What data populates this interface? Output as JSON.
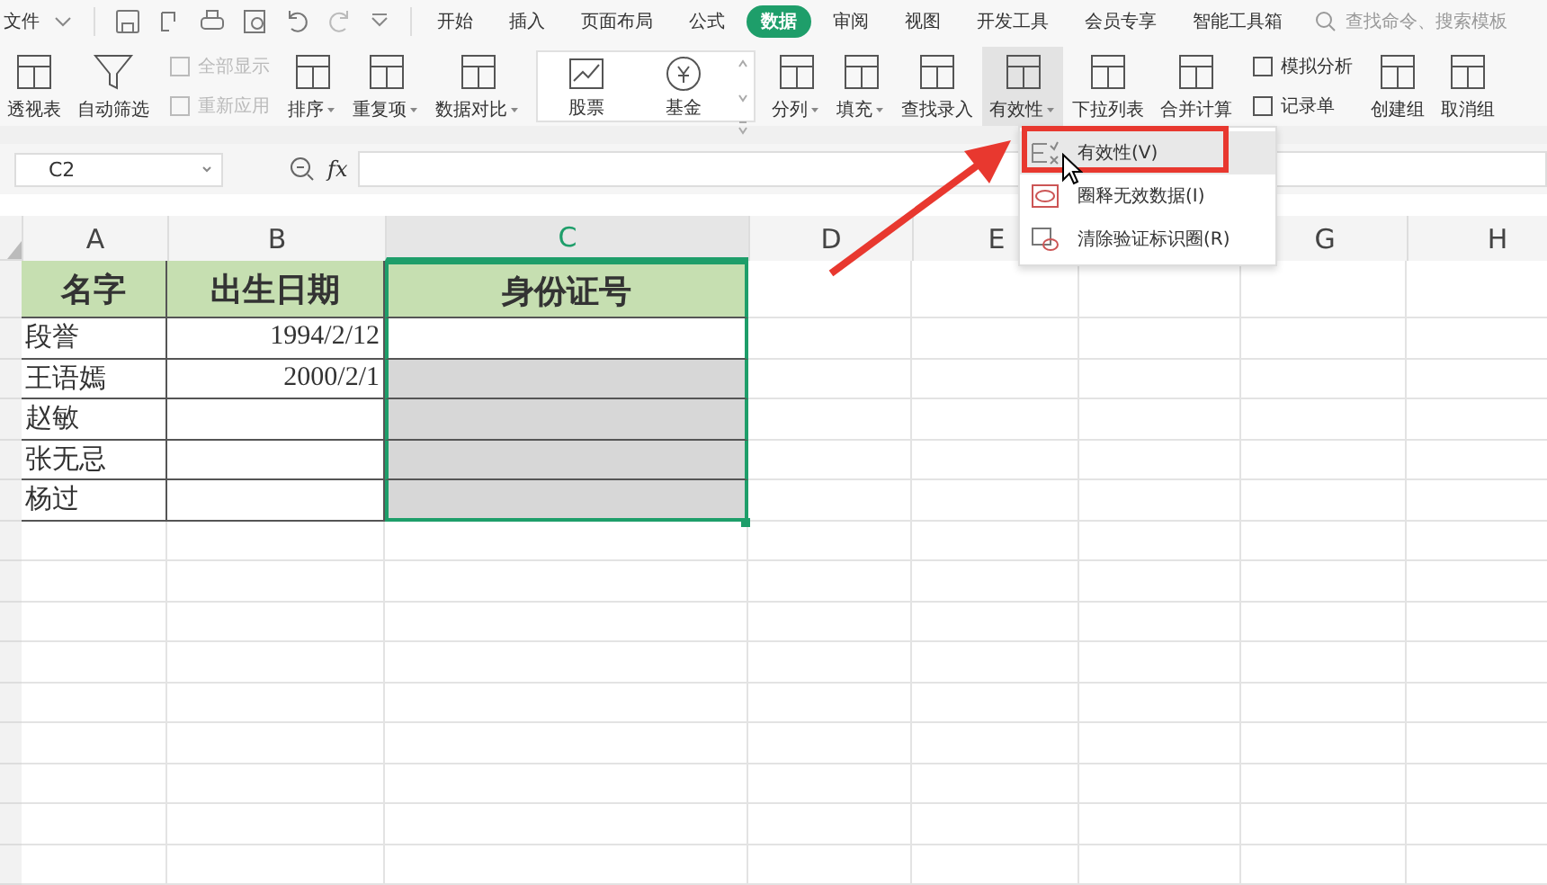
{
  "menu_bar": {
    "file_menu": "文件",
    "tabs": [
      {
        "label": "开始",
        "selected": false
      },
      {
        "label": "插入",
        "selected": false
      },
      {
        "label": "页面布局",
        "selected": false
      },
      {
        "label": "公式",
        "selected": false
      },
      {
        "label": "数据",
        "selected": true
      },
      {
        "label": "审阅",
        "selected": false
      },
      {
        "label": "视图",
        "selected": false
      },
      {
        "label": "开发工具",
        "selected": false
      },
      {
        "label": "会员专享",
        "selected": false
      },
      {
        "label": "智能工具箱",
        "selected": false
      }
    ],
    "search": {
      "placeholder": "查找命令、搜索模板"
    }
  },
  "ribbon": [
    {
      "kind": "big",
      "label": "透视表",
      "menu": false,
      "selected": false
    },
    {
      "kind": "big",
      "label": "自动筛选",
      "menu": false,
      "selected": false
    },
    {
      "kind": "small",
      "items": [
        {
          "label": "全部显示",
          "disabled": true
        },
        {
          "label": "重新应用",
          "disabled": true
        }
      ]
    },
    {
      "kind": "big",
      "label": "排序",
      "menu": true,
      "selected": false
    },
    {
      "kind": "big",
      "label": "重复项",
      "menu": true,
      "selected": false
    },
    {
      "kind": "big",
      "label": "数据对比",
      "menu": true,
      "selected": false
    },
    {
      "kind": "gallery",
      "items": [
        {
          "label": "股票"
        },
        {
          "label": "基金"
        }
      ]
    },
    {
      "kind": "big",
      "label": "分列",
      "menu": true,
      "selected": false
    },
    {
      "kind": "big",
      "label": "填充",
      "menu": true,
      "selected": false
    },
    {
      "kind": "big",
      "label": "查找录入",
      "menu": false,
      "selected": false
    },
    {
      "kind": "big",
      "label": "有效性",
      "menu": true,
      "selected": true
    },
    {
      "kind": "big",
      "label": "下拉列表",
      "menu": false,
      "selected": false
    },
    {
      "kind": "big",
      "label": "合并计算",
      "menu": false,
      "selected": false
    },
    {
      "kind": "small",
      "items": [
        {
          "label": "模拟分析",
          "disabled": false
        },
        {
          "label": "记录单",
          "disabled": false
        }
      ]
    },
    {
      "kind": "big",
      "label": "创建组",
      "menu": false,
      "selected": false
    },
    {
      "kind": "big",
      "label": "取消组",
      "menu": false,
      "selected": false
    }
  ],
  "formula_bar": {
    "name_box": "C2",
    "fx": "fx"
  },
  "columns": [
    {
      "label": "A",
      "selected": false
    },
    {
      "label": "B",
      "selected": false
    },
    {
      "label": "C",
      "selected": true
    },
    {
      "label": "D",
      "selected": false
    },
    {
      "label": "E",
      "selected": false
    },
    {
      "label": "G",
      "selected": false
    },
    {
      "label": "H",
      "selected": false
    }
  ],
  "table": {
    "headers": [
      "名字",
      "出生日期",
      "身份证号"
    ],
    "rows": [
      {
        "name": "段誉",
        "birth": "1994/2/12",
        "active": true
      },
      {
        "name": "王语嫣",
        "birth": "2000/2/1",
        "active": false
      },
      {
        "name": "赵敏",
        "active": false
      },
      {
        "name": "张无忌",
        "active": false
      },
      {
        "name": "杨过",
        "active": false
      }
    ]
  },
  "validation_menu": [
    {
      "label": "有效性(V)",
      "selected": true
    },
    {
      "label": "圈释无效数据(I)",
      "selected": false
    },
    {
      "label": "清除验证标识圈(R)",
      "selected": false
    }
  ]
}
